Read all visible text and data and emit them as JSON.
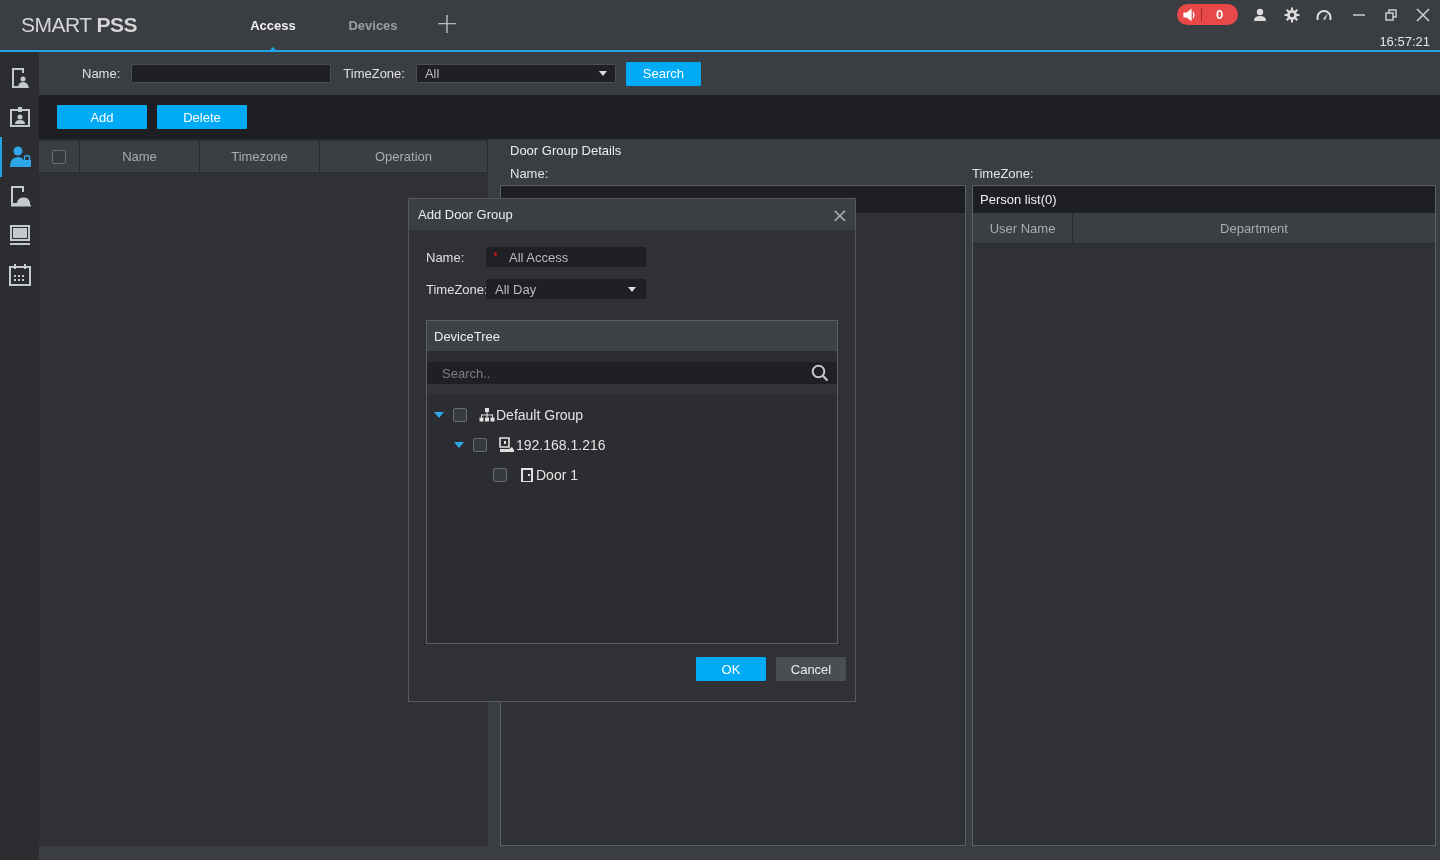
{
  "app": {
    "logo_light": "SMART ",
    "logo_bold": "PSS",
    "tabs": [
      {
        "label": "Access",
        "selected": true
      },
      {
        "label": "Devices",
        "selected": false
      }
    ],
    "add_tab": "+",
    "alarm_count": "0",
    "clock": "16:57:21"
  },
  "sidebar": {
    "items": [
      {
        "kind": "door-person",
        "selected": false
      },
      {
        "kind": "badge",
        "selected": false
      },
      {
        "kind": "person-lock",
        "selected": true
      },
      {
        "kind": "door-dome",
        "selected": false
      },
      {
        "kind": "monitor",
        "selected": false
      },
      {
        "kind": "calendar",
        "selected": false
      }
    ]
  },
  "filter": {
    "name_label": "Name:",
    "timezone_label": "TimeZone:",
    "timezone_value": "All",
    "search_button": "Search"
  },
  "actions": [
    "Add",
    "Delete"
  ],
  "table": {
    "select_all_checked": false,
    "columns": [
      "Name",
      "Timezone",
      "Operation"
    ]
  },
  "details": {
    "title": "Door Group Details",
    "name_label": "Name:",
    "timezone_label": "TimeZone:",
    "person_list": {
      "title": "Person list(0)",
      "columns": [
        "User Name",
        "Department"
      ]
    }
  },
  "dialog": {
    "title": "Add Door Group",
    "close": "×",
    "name_label": "Name:",
    "name_value": "All Access",
    "timezone_label": "TimeZone:",
    "timezone_value": "All Day",
    "device_tree": {
      "title": "DeviceTree",
      "search_placeholder": "Search..",
      "nodes": [
        {
          "kind": "group",
          "label": "Default Group",
          "expanded": true,
          "checked": false,
          "children": [
            {
              "kind": "device",
              "label": "192.168.1.216",
              "expanded": true,
              "checked": false,
              "children": [
                {
                  "kind": "door",
                  "label": "Door 1",
                  "checked": false
                }
              ]
            }
          ]
        }
      ]
    },
    "buttons": [
      {
        "label": "OK",
        "kind": "primary"
      },
      {
        "label": "Cancel",
        "kind": "secondary"
      }
    ]
  }
}
